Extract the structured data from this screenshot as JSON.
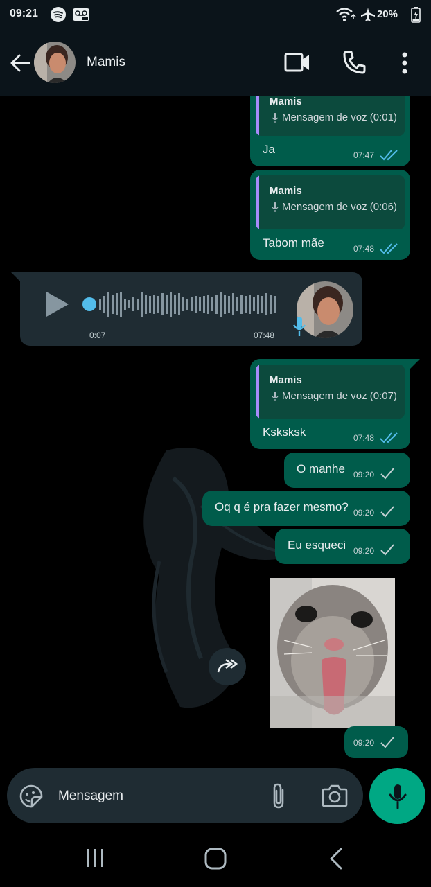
{
  "status_bar": {
    "time": "09:21",
    "battery": "20%",
    "left_icons": [
      "spotify-icon",
      "voicemail-icon"
    ],
    "right_icons": [
      "wifi-icon",
      "airplane-icon",
      "battery-icon"
    ]
  },
  "header": {
    "contact_name": "Mamis",
    "actions": [
      "video-call-icon",
      "voice-call-icon",
      "more-options-icon"
    ]
  },
  "messages": [
    {
      "type": "reply",
      "direction": "out",
      "quote_name": "Mamis",
      "quote_text": "Mensagem de voz (0:01)",
      "text": "Ja",
      "time": "07:47",
      "status": "read"
    },
    {
      "type": "reply",
      "direction": "out",
      "quote_name": "Mamis",
      "quote_text": "Mensagem de voz (0:06)",
      "text": "Tabom mãe",
      "time": "07:48",
      "status": "read"
    },
    {
      "type": "voice",
      "direction": "in",
      "duration": "0:07",
      "time": "07:48"
    },
    {
      "type": "reply",
      "direction": "out",
      "quote_name": "Mamis",
      "quote_text": "Mensagem de voz (0:07)",
      "text": "Ksksksk",
      "time": "07:48",
      "status": "read"
    },
    {
      "type": "text",
      "direction": "out",
      "text": "O manhe",
      "time": "09:20",
      "status": "sent"
    },
    {
      "type": "text",
      "direction": "out",
      "text": "Oq q é pra fazer mesmo?",
      "time": "09:20",
      "status": "sent"
    },
    {
      "type": "text",
      "direction": "out",
      "text": "Eu esqueci",
      "time": "09:20",
      "status": "sent"
    },
    {
      "type": "image",
      "direction": "out",
      "time": "09:20",
      "status": "sent"
    }
  ],
  "composer": {
    "placeholder": "Mensagem",
    "icons": [
      "sticker-icon",
      "attach-icon",
      "camera-icon",
      "mic-icon"
    ]
  },
  "colors": {
    "outgoing_bubble": "#005c4b",
    "incoming_bubble": "#1f2c33",
    "read_ticks": "#53bdeb",
    "accent": "#00a884"
  }
}
